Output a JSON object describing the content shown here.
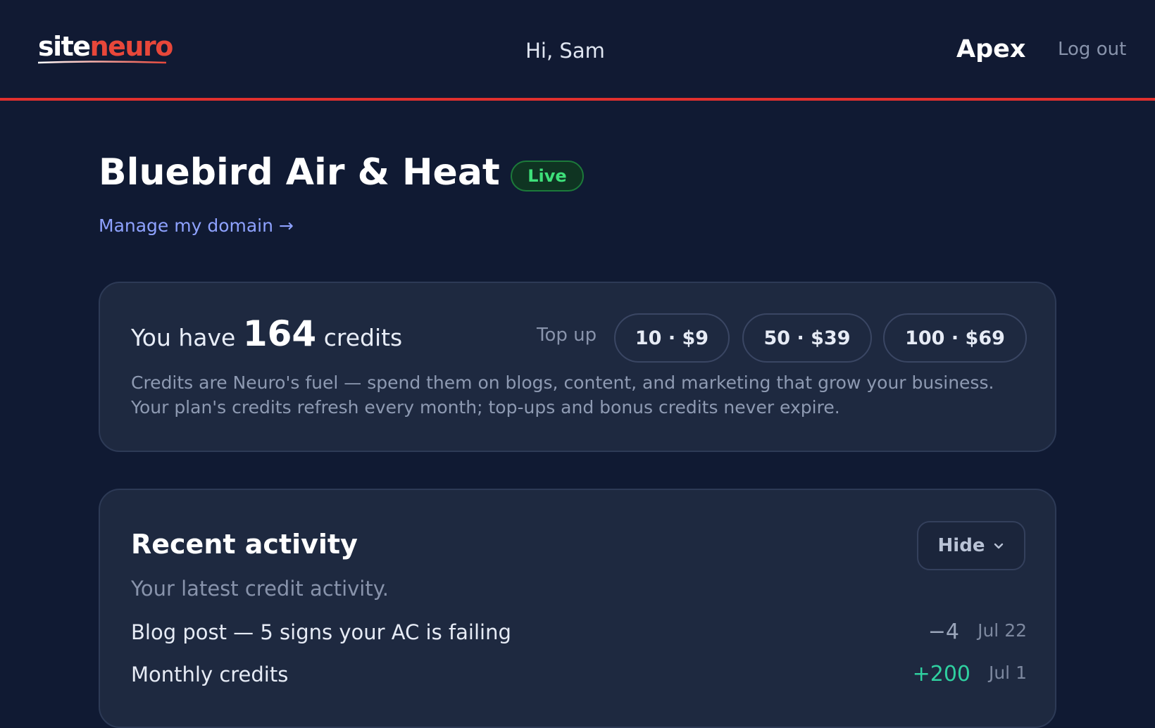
{
  "header": {
    "logo_part1": "site",
    "logo_part2": "neuro",
    "greeting": "Hi, Sam",
    "plan": "Apex",
    "logout": "Log out"
  },
  "business": {
    "name": "Bluebird Air & Heat",
    "status": "Live",
    "manage_domain": "Manage my domain →"
  },
  "credits": {
    "prefix": "You have",
    "count": "164",
    "suffix": "credits",
    "topup_label": "Top up",
    "options": [
      "10 · $9",
      "50 · $39",
      "100 · $69"
    ],
    "description_line1": "Credits are Neuro's fuel — spend them on blogs, content, and marketing that grow your business.",
    "description_line2": "Your plan's credits refresh every month; top-ups and bonus credits never expire."
  },
  "activity": {
    "title": "Recent activity",
    "toggle": "Hide",
    "subtitle": "Your latest credit activity.",
    "items": [
      {
        "label": "Blog post — 5 signs your AC is failing",
        "amount": "−4",
        "date": "Jul 22"
      },
      {
        "label": "Monthly credits",
        "amount": "+200",
        "date": "Jul 1"
      }
    ]
  },
  "colors": {
    "accent_red": "#e0302e",
    "live_green": "#3ee07a",
    "credit_green": "#2fd0a0",
    "link_blue": "#8ea2ff"
  }
}
